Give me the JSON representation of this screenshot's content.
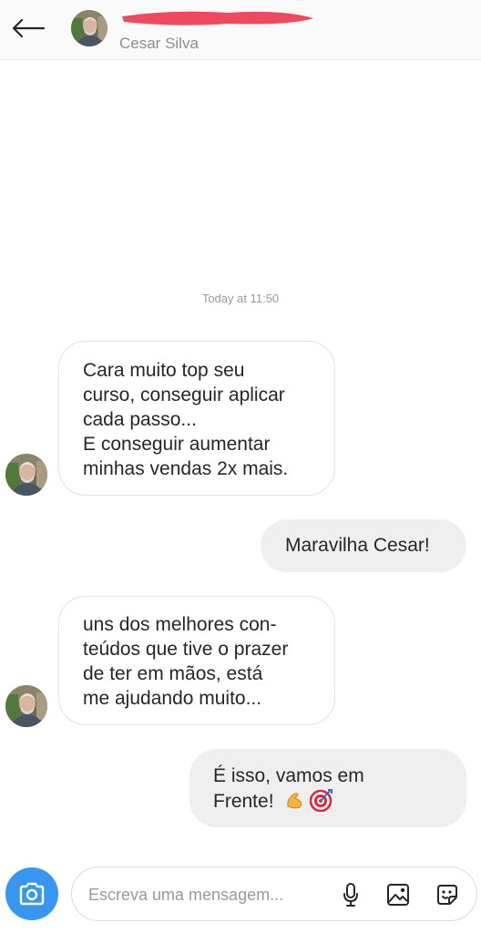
{
  "header": {
    "contact_name": "Cesar Silva",
    "back_icon": "arrow-left-icon",
    "redaction_color": "#f0485f"
  },
  "conversation": {
    "timestamp": "Today at 11:50",
    "messages": [
      {
        "direction": "received",
        "lines": [
          "Cara muito top seu",
          "curso, conseguir aplicar",
          "cada passo...",
          "E conseguir aumentar",
          "minhas vendas 2x mais."
        ]
      },
      {
        "direction": "sent",
        "lines": [
          "Maravilha Cesar!"
        ]
      },
      {
        "direction": "received",
        "lines": [
          "uns dos melhores con-",
          "teúdos que tive o prazer",
          "de ter em mãos, está",
          "me ajudando muito..."
        ]
      },
      {
        "direction": "sent",
        "lines": [
          "É isso, vamos em",
          "Frente!"
        ],
        "emojis": [
          "flexed-biceps-icon",
          "direct-hit-target-icon"
        ]
      }
    ]
  },
  "composer": {
    "placeholder": "Escreva uma mensagem...",
    "camera_icon": "camera-icon",
    "mic_icon": "microphone-icon",
    "gallery_icon": "image-icon",
    "sticker_icon": "sticker-icon"
  },
  "colors": {
    "accent": "#3797f0",
    "sent_bubble": "#efefef",
    "received_border": "#e3e3e3",
    "text": "#262626",
    "muted": "#8e8e8e"
  }
}
